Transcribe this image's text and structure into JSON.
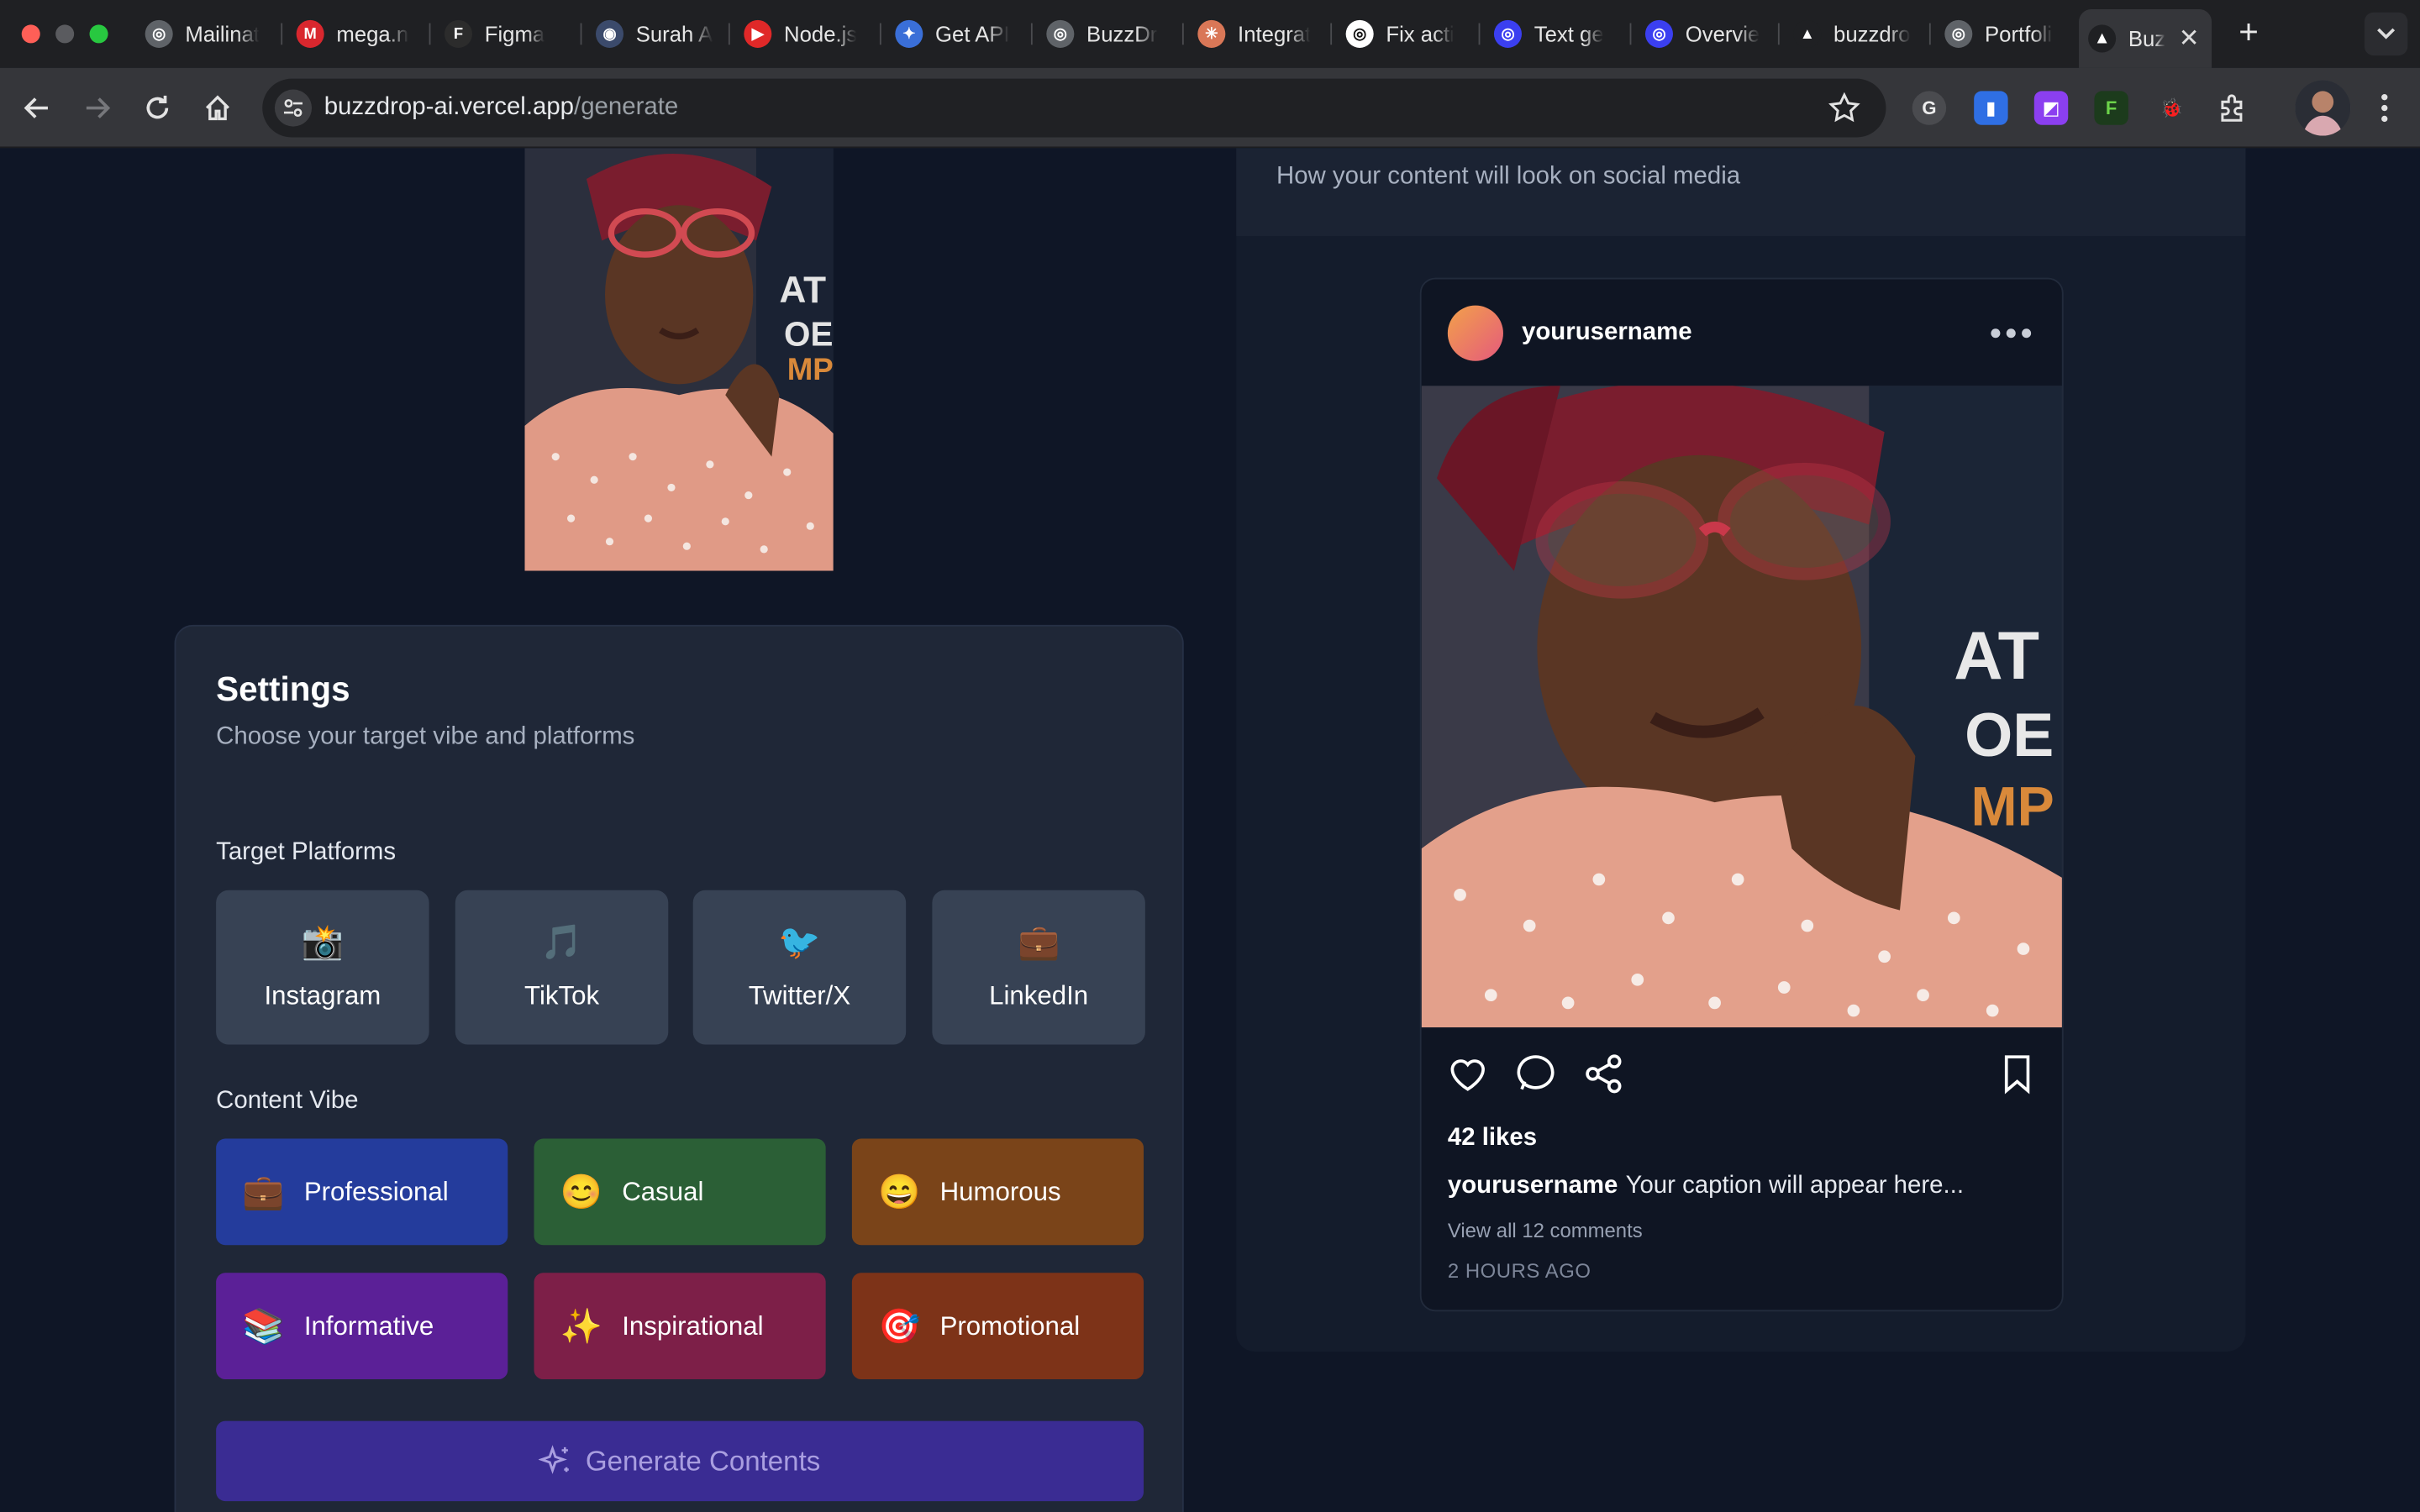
{
  "browser": {
    "tabs": [
      {
        "label": "Mailinat",
        "fav_bg": "#5f6368",
        "fav_glyph": "◎"
      },
      {
        "label": "mega.n",
        "fav_bg": "#d9272e",
        "fav_glyph": "M"
      },
      {
        "label": "Figma",
        "fav_bg": "#2c2c2c",
        "fav_glyph": "F"
      },
      {
        "label": "Surah A",
        "fav_bg": "#3b4a6b",
        "fav_glyph": "◉"
      },
      {
        "label": "Node.js",
        "fav_bg": "#e02828",
        "fav_glyph": "▶"
      },
      {
        "label": "Get API",
        "fav_bg": "#3a6fd8",
        "fav_glyph": "✦"
      },
      {
        "label": "BuzzDr",
        "fav_bg": "#5f6368",
        "fav_glyph": "◎"
      },
      {
        "label": "Integrat",
        "fav_bg": "#d97757",
        "fav_glyph": "✳"
      },
      {
        "label": "Fix acti",
        "fav_bg": "#ffffff",
        "fav_glyph": "◎"
      },
      {
        "label": "Text ge",
        "fav_bg": "#3b3ff0",
        "fav_glyph": "◎"
      },
      {
        "label": "Overvie",
        "fav_bg": "#3b3ff0",
        "fav_glyph": "◎"
      },
      {
        "label": "buzzdro",
        "fav_bg": "#1f2023",
        "fav_glyph": "▲"
      },
      {
        "label": "Portfoli",
        "fav_bg": "#5f6368",
        "fav_glyph": "◎"
      }
    ],
    "active_tab": {
      "label": "Buz",
      "fav_glyph": "▲"
    },
    "url_host": "buzzdrop-ai.vercel.app",
    "url_path": "/generate",
    "icons": [
      "back-icon",
      "forward-icon",
      "reload-icon",
      "home-icon",
      "star-icon",
      "profile-avatar"
    ]
  },
  "settings": {
    "title": "Settings",
    "subtitle": "Choose your target vibe and platforms",
    "platforms_label": "Target Platforms",
    "platforms": [
      {
        "emoji": "📸",
        "label": "Instagram"
      },
      {
        "emoji": "🎵",
        "label": "TikTok"
      },
      {
        "emoji": "🐦",
        "label": "Twitter/X"
      },
      {
        "emoji": "💼",
        "label": "LinkedIn"
      }
    ],
    "vibe_label": "Content Vibe",
    "vibes": [
      {
        "emoji": "💼",
        "label": "Professional",
        "color": "#243c9c"
      },
      {
        "emoji": "😊",
        "label": "Casual",
        "color": "#2b5f36"
      },
      {
        "emoji": "😄",
        "label": "Humorous",
        "color": "#7a4419"
      },
      {
        "emoji": "📚",
        "label": "Informative",
        "color": "#5b2097"
      },
      {
        "emoji": "✨",
        "label": "Inspirational",
        "color": "#7d1f48"
      },
      {
        "emoji": "🎯",
        "label": "Promotional",
        "color": "#7d3318"
      }
    ],
    "generate_label": "Generate Contents"
  },
  "preview": {
    "subtitle": "How your content will look on social media",
    "username": "yourusername",
    "likes": "42 likes",
    "caption_user": "yourusername",
    "caption_text": "Your caption will appear here...",
    "comments": "View all 12 comments",
    "time": "2 HOURS AGO"
  }
}
